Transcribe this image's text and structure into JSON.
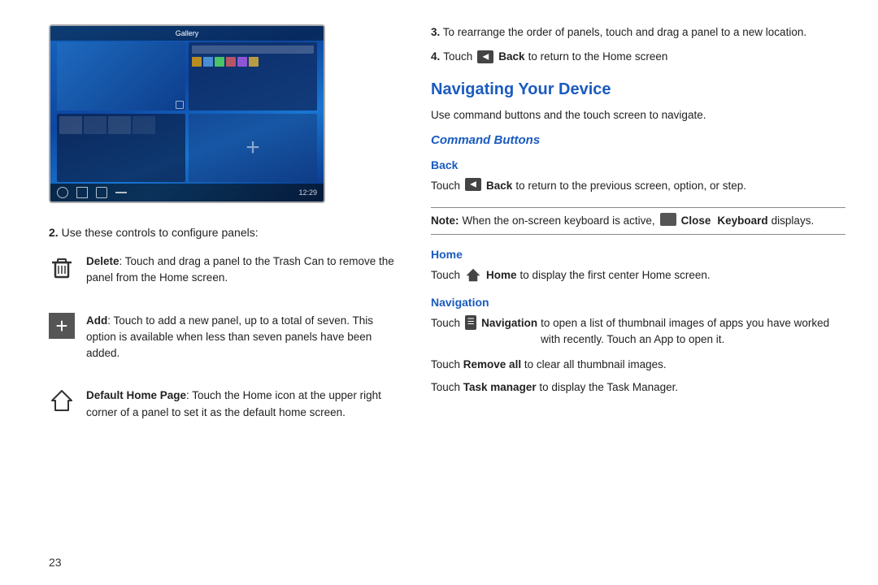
{
  "page": {
    "number": "23"
  },
  "left": {
    "device_image": {
      "status": "12:29"
    },
    "step2": {
      "intro": "Use these controls to configure panels:"
    },
    "controls": [
      {
        "id": "delete",
        "icon_type": "trash",
        "label": "Delete",
        "description": ": Touch and drag a panel to the Trash Can to remove the panel from the Home screen."
      },
      {
        "id": "add",
        "icon_type": "plus",
        "label": "Add",
        "description": ": Touch to add a new panel, up to a total of seven. This option is available when less than seven panels have been added."
      },
      {
        "id": "default-home",
        "icon_type": "house",
        "label": "Default Home Page",
        "description": ": Touch the Home icon at the upper right corner of a panel to set it as the default home screen."
      }
    ]
  },
  "right": {
    "step3": {
      "number": "3.",
      "text": "To rearrange the order of panels, touch and drag a panel to a new location."
    },
    "step4": {
      "number": "4.",
      "pre": "Touch",
      "icon": "back",
      "bold": "Back",
      "post": "to return to the Home screen"
    },
    "section_title": "Navigating Your Device",
    "section_intro": "Use command buttons and the touch screen to navigate.",
    "command_buttons_label": "Command Buttons",
    "back_subsection": {
      "title": "Back",
      "pre": "Touch",
      "icon": "back",
      "bold": "Back",
      "post": "to return to the previous screen, option, or step."
    },
    "note": {
      "label": "Note:",
      "text": "When the on-screen keyboard is active,",
      "icon": "close-kbd",
      "bold1": "Close",
      "bold2": "Keyboard",
      "text2": "displays."
    },
    "home_subsection": {
      "title": "Home",
      "pre": "Touch",
      "icon": "home",
      "bold": "Home",
      "post": "to display the first center Home screen."
    },
    "navigation_subsection": {
      "title": "Navigation",
      "pre": "Touch",
      "icon": "nav",
      "bold": "Navigation",
      "post": "to open a list of thumbnail images of apps you have worked with recently. Touch an App to open it."
    },
    "remove_all": "Touch ",
    "remove_all_bold": "Remove all",
    "remove_all_post": " to clear all thumbnail images.",
    "task_manager": "Touch ",
    "task_manager_bold": "Task manager",
    "task_manager_post": " to display the Task Manager."
  }
}
